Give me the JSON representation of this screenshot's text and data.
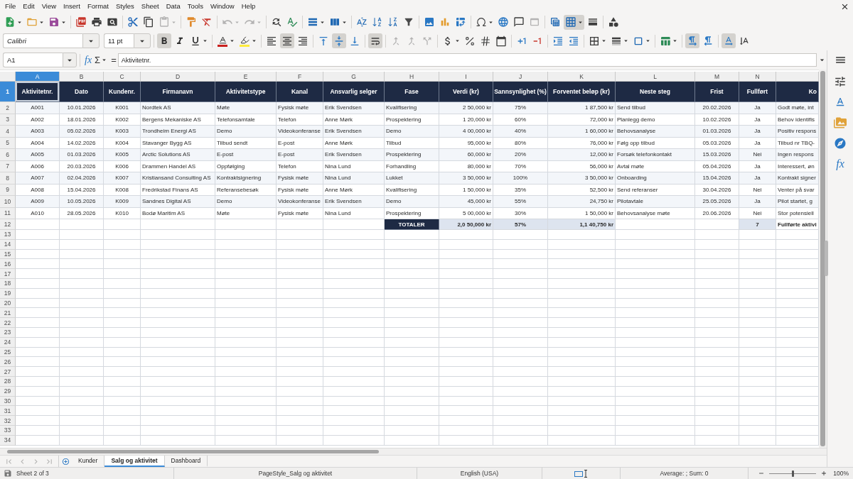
{
  "menu_bar": {
    "items": [
      "File",
      "Edit",
      "View",
      "Insert",
      "Format",
      "Styles",
      "Sheet",
      "Data",
      "Tools",
      "Window",
      "Help"
    ]
  },
  "standard_toolbar": {
    "groups": [
      {
        "buttons": [
          {
            "kind": "new",
            "pressed": false,
            "disabled": false,
            "dropdown": true
          },
          {
            "kind": "open",
            "pressed": false,
            "disabled": false,
            "dropdown": true
          },
          {
            "kind": "save",
            "pressed": false,
            "disabled": false,
            "dropdown": true
          }
        ]
      },
      {
        "buttons": [
          {
            "kind": "pdf",
            "pressed": false,
            "disabled": false,
            "dropdown": false
          },
          {
            "kind": "print",
            "pressed": false,
            "disabled": false,
            "dropdown": false
          },
          {
            "kind": "preview",
            "pressed": false,
            "disabled": false,
            "dropdown": false
          }
        ]
      },
      {
        "buttons": [
          {
            "kind": "cut",
            "pressed": false,
            "disabled": false,
            "dropdown": false
          },
          {
            "kind": "copy",
            "pressed": false,
            "disabled": false,
            "dropdown": false
          },
          {
            "kind": "paste",
            "pressed": false,
            "disabled": true,
            "dropdown": true
          }
        ]
      },
      {
        "buttons": [
          {
            "kind": "clone",
            "pressed": false,
            "disabled": false,
            "dropdown": false
          },
          {
            "kind": "clear",
            "pressed": false,
            "disabled": false,
            "dropdown": false
          }
        ]
      },
      {
        "buttons": [
          {
            "kind": "undo",
            "pressed": false,
            "disabled": true,
            "dropdown": true
          },
          {
            "kind": "redo",
            "pressed": false,
            "disabled": true,
            "dropdown": true
          }
        ]
      },
      {
        "buttons": [
          {
            "kind": "find",
            "pressed": false,
            "disabled": false,
            "dropdown": false
          },
          {
            "kind": "spelling",
            "pressed": false,
            "disabled": false,
            "dropdown": false
          }
        ]
      },
      {
        "buttons": [
          {
            "kind": "rows",
            "pressed": false,
            "disabled": false,
            "dropdown": true
          },
          {
            "kind": "columns",
            "pressed": false,
            "disabled": false,
            "dropdown": true
          }
        ]
      },
      {
        "buttons": [
          {
            "kind": "sort",
            "pressed": false,
            "disabled": false,
            "dropdown": false
          },
          {
            "kind": "ascending",
            "pressed": false,
            "disabled": false,
            "dropdown": false
          },
          {
            "kind": "descending",
            "pressed": false,
            "disabled": false,
            "dropdown": false
          },
          {
            "kind": "autofilter",
            "pressed": false,
            "disabled": false,
            "dropdown": false
          }
        ]
      },
      {
        "buttons": [
          {
            "kind": "image",
            "pressed": false,
            "disabled": false,
            "dropdown": false
          },
          {
            "kind": "chart",
            "pressed": false,
            "disabled": false,
            "dropdown": false
          },
          {
            "kind": "pivot",
            "pressed": false,
            "disabled": false,
            "dropdown": false
          }
        ]
      },
      {
        "buttons": [
          {
            "kind": "symbol",
            "pressed": false,
            "disabled": false,
            "dropdown": true
          },
          {
            "kind": "hyperlink",
            "pressed": false,
            "disabled": false,
            "dropdown": false
          },
          {
            "kind": "comment",
            "pressed": false,
            "disabled": false,
            "dropdown": false
          },
          {
            "kind": "headerfooter",
            "pressed": false,
            "disabled": true,
            "dropdown": false
          }
        ]
      },
      {
        "buttons": [
          {
            "kind": "printarea",
            "pressed": false,
            "disabled": false,
            "dropdown": false
          },
          {
            "kind": "freeze",
            "pressed": true,
            "disabled": false,
            "dropdown": true
          },
          {
            "kind": "split",
            "pressed": false,
            "disabled": false,
            "dropdown": false
          }
        ]
      },
      {
        "buttons": [
          {
            "kind": "draw",
            "pressed": false,
            "disabled": false,
            "dropdown": false
          }
        ]
      }
    ]
  },
  "formatting_toolbar": {
    "font_name": "Calibri",
    "font_size": "11 pt",
    "groups": [
      {
        "buttons": [
          {
            "kind": "bold",
            "pressed": true,
            "disabled": false,
            "dropdown": false
          },
          {
            "kind": "italic",
            "pressed": false,
            "disabled": false,
            "dropdown": false
          },
          {
            "kind": "underline",
            "pressed": false,
            "disabled": false,
            "dropdown": true
          }
        ]
      },
      {
        "buttons": [
          {
            "kind": "fontcolor",
            "pressed": false,
            "disabled": false,
            "dropdown": true
          },
          {
            "kind": "highlight",
            "pressed": false,
            "disabled": false,
            "dropdown": true
          }
        ]
      },
      {
        "buttons": [
          {
            "kind": "alignleft",
            "pressed": false,
            "disabled": false,
            "dropdown": false
          },
          {
            "kind": "aligncenter",
            "pressed": true,
            "disabled": false,
            "dropdown": false
          },
          {
            "kind": "alignright",
            "pressed": false,
            "disabled": false,
            "dropdown": false
          }
        ]
      },
      {
        "buttons": [
          {
            "kind": "aligntop",
            "pressed": false,
            "disabled": false,
            "dropdown": false
          },
          {
            "kind": "middle",
            "pressed": true,
            "disabled": false,
            "dropdown": false
          },
          {
            "kind": "alignbottom",
            "pressed": false,
            "disabled": false,
            "dropdown": false
          }
        ]
      },
      {
        "buttons": [
          {
            "kind": "wrap",
            "pressed": true,
            "disabled": false,
            "dropdown": false
          }
        ]
      },
      {
        "buttons": [
          {
            "kind": "mergecenter",
            "pressed": false,
            "disabled": true,
            "dropdown": false
          },
          {
            "kind": "merge",
            "pressed": false,
            "disabled": true,
            "dropdown": false
          },
          {
            "kind": "unmerge",
            "pressed": false,
            "disabled": true,
            "dropdown": false
          }
        ]
      },
      {
        "buttons": [
          {
            "kind": "currency",
            "pressed": false,
            "disabled": false,
            "dropdown": true
          },
          {
            "kind": "percent",
            "pressed": false,
            "disabled": false,
            "dropdown": false
          },
          {
            "kind": "number",
            "pressed": false,
            "disabled": false,
            "dropdown": false
          },
          {
            "kind": "date",
            "pressed": false,
            "disabled": false,
            "dropdown": false
          }
        ]
      },
      {
        "buttons": [
          {
            "kind": "adddecimal",
            "pressed": false,
            "disabled": false,
            "dropdown": false
          },
          {
            "kind": "deletedecimal",
            "pressed": false,
            "disabled": false,
            "dropdown": false
          }
        ]
      },
      {
        "buttons": [
          {
            "kind": "indent",
            "pressed": false,
            "disabled": false,
            "dropdown": false
          },
          {
            "kind": "outdent",
            "pressed": false,
            "disabled": false,
            "dropdown": false
          }
        ]
      },
      {
        "buttons": [
          {
            "kind": "borders",
            "pressed": false,
            "disabled": false,
            "dropdown": true
          },
          {
            "kind": "borderstyle",
            "pressed": false,
            "disabled": false,
            "dropdown": true
          },
          {
            "kind": "bordercolor",
            "pressed": false,
            "disabled": false,
            "dropdown": true
          }
        ]
      },
      {
        "buttons": [
          {
            "kind": "conditional",
            "pressed": false,
            "disabled": false,
            "dropdown": true
          }
        ]
      },
      {
        "buttons": [
          {
            "kind": "ltr",
            "pressed": true,
            "disabled": false,
            "dropdown": false
          },
          {
            "kind": "rtl",
            "pressed": false,
            "disabled": false,
            "dropdown": false
          }
        ]
      },
      {
        "buttons": [
          {
            "kind": "horizontal",
            "pressed": true,
            "disabled": false,
            "dropdown": false
          },
          {
            "kind": "vertical",
            "pressed": false,
            "disabled": false,
            "dropdown": false
          }
        ]
      }
    ]
  },
  "formula_bar": {
    "name_box": "A1",
    "function_glyph": "fx",
    "sum_glyph": "Σ",
    "equals_glyph": "=",
    "content": "Aktivitetnr."
  },
  "sheet": {
    "columns": [
      {
        "label": "A",
        "selected": true
      },
      {
        "label": "B",
        "selected": false
      },
      {
        "label": "C",
        "selected": false
      },
      {
        "label": "D",
        "selected": false
      },
      {
        "label": "E",
        "selected": false
      },
      {
        "label": "F",
        "selected": false
      },
      {
        "label": "G",
        "selected": false
      },
      {
        "label": "H",
        "selected": false
      },
      {
        "label": "I",
        "selected": false
      },
      {
        "label": "J",
        "selected": false
      },
      {
        "label": "K",
        "selected": false
      },
      {
        "label": "L",
        "selected": false
      },
      {
        "label": "M",
        "selected": false
      },
      {
        "label": "N",
        "selected": false
      },
      {
        "selected": false
      }
    ],
    "header_row": {
      "number": "1",
      "selected": true,
      "cells": [
        "Aktivitetnr.",
        "Dato",
        "Kundenr.",
        "Firmanavn",
        "Aktivitetstype",
        "Kanal",
        "Ansvarlig selger",
        "Fase",
        "Verdi (kr)",
        "Sannsynlighet (%)",
        "Forventet beløp (kr)",
        "Neste steg",
        "Frist",
        "Fullført",
        "Ko"
      ]
    },
    "rows": [
      {
        "number": "2",
        "selected": false,
        "cells": [
          "A001",
          "10.01.2026",
          "K001",
          "Nordtek AS",
          "Møte",
          "Fysisk møte",
          "Erik Svendsen",
          "Kvalifisering",
          "2 50,000 kr",
          "75%",
          "1 87,500 kr",
          "Send tilbud",
          "20.02.2026",
          "Ja",
          "Godt møte, int"
        ]
      },
      {
        "number": "3",
        "selected": false,
        "cells": [
          "A002",
          "18.01.2026",
          "K002",
          "Bergens Mekaniske AS",
          "Telefonsamtale",
          "Telefon",
          "Anne Mørk",
          "Prospektering",
          "1 20,000 kr",
          "60%",
          "72,000 kr",
          "Planlegg demo",
          "10.02.2026",
          "Ja",
          "Behov identifis"
        ]
      },
      {
        "number": "4",
        "selected": false,
        "cells": [
          "A003",
          "05.02.2026",
          "K003",
          "Trondheim Energi AS",
          "Demo",
          "Videokonferanse",
          "Erik Svendsen",
          "Demo",
          "4 00,000 kr",
          "40%",
          "1 60,000 kr",
          "Behovsanalyse",
          "01.03.2026",
          "Ja",
          "Positiv respons"
        ]
      },
      {
        "number": "5",
        "selected": false,
        "cells": [
          "A004",
          "14.02.2026",
          "K004",
          "Stavanger Bygg AS",
          "Tilbud sendt",
          "E-post",
          "Anne Mørk",
          "Tilbud",
          "95,000 kr",
          "80%",
          "76,000 kr",
          "Følg opp tilbud",
          "05.03.2026",
          "Ja",
          "Tilbud nr TBQ-"
        ]
      },
      {
        "number": "6",
        "selected": false,
        "cells": [
          "A005",
          "01.03.2026",
          "K005",
          "Arctic Solutions AS",
          "E-post",
          "E-post",
          "Erik Svendsen",
          "Prospektering",
          "60,000 kr",
          "20%",
          "12,000 kr",
          "Forsøk telefonkontakt",
          "15.03.2026",
          "Nei",
          "Ingen respons"
        ]
      },
      {
        "number": "7",
        "selected": false,
        "cells": [
          "A006",
          "20.03.2026",
          "K006",
          "Drammen Handel AS",
          "Oppfølging",
          "Telefon",
          "Nina Lund",
          "Forhandling",
          "80,000 kr",
          "70%",
          "56,000 kr",
          "Avtal møte",
          "05.04.2026",
          "Ja",
          "Interessert, øn"
        ]
      },
      {
        "number": "8",
        "selected": false,
        "cells": [
          "A007",
          "02.04.2026",
          "K007",
          "Kristiansand Consulting AS",
          "Kontraktsignering",
          "Fysisk møte",
          "Nina Lund",
          "Lukket",
          "3 50,000 kr",
          "100%",
          "3 50,000 kr",
          "Onboarding",
          "15.04.2026",
          "Ja",
          "Kontrakt signer"
        ]
      },
      {
        "number": "9",
        "selected": false,
        "cells": [
          "A008",
          "15.04.2026",
          "K008",
          "Fredrikstad Finans AS",
          "Referansebesøk",
          "Fysisk møte",
          "Anne Mørk",
          "Kvalifisering",
          "1 50,000 kr",
          "35%",
          "52,500 kr",
          "Send referanser",
          "30.04.2026",
          "Nei",
          "Venter på svar"
        ]
      },
      {
        "number": "10",
        "selected": false,
        "cells": [
          "A009",
          "10.05.2026",
          "K009",
          "Sandnes Digital AS",
          "Demo",
          "Videokonferanse",
          "Erik Svendsen",
          "Demo",
          "45,000 kr",
          "55%",
          "24,750 kr",
          "Pilotavtale",
          "25.05.2026",
          "Ja",
          "Pilot startet, g"
        ]
      },
      {
        "number": "11",
        "selected": false,
        "cells": [
          "A010",
          "28.05.2026",
          "K010",
          "Bodø Maritim AS",
          "Møte",
          "Fysisk møte",
          "Nina Lund",
          "Prospektering",
          "5 00,000 kr",
          "30%",
          "1 50,000 kr",
          "Behovsanalyse møte",
          "20.06.2026",
          "Nei",
          "Stor potensiell"
        ]
      }
    ],
    "totals_row": {
      "number": "12",
      "selected": false,
      "label": "TOTALER",
      "value_total": "2,0 50,000 kr",
      "probability_average": "57%",
      "expected_total": "1,1 40,750 kr",
      "completed_count": "7",
      "note": "Fullførte aktivi"
    },
    "empty_rows": [
      {
        "number": "13",
        "selected": false
      },
      {
        "number": "14",
        "selected": false
      },
      {
        "number": "15",
        "selected": false
      },
      {
        "number": "16",
        "selected": false
      },
      {
        "number": "17",
        "selected": false
      },
      {
        "number": "18",
        "selected": false
      },
      {
        "number": "19",
        "selected": false
      },
      {
        "number": "20",
        "selected": false
      },
      {
        "number": "21",
        "selected": false
      },
      {
        "number": "22",
        "selected": false
      },
      {
        "number": "23",
        "selected": false
      },
      {
        "number": "24",
        "selected": false
      },
      {
        "number": "25",
        "selected": false
      },
      {
        "number": "26",
        "selected": false
      },
      {
        "number": "27",
        "selected": false
      },
      {
        "number": "28",
        "selected": false
      },
      {
        "number": "29",
        "selected": false
      },
      {
        "number": "30",
        "selected": false
      },
      {
        "number": "31",
        "selected": false
      },
      {
        "number": "32",
        "selected": false
      },
      {
        "number": "33",
        "selected": false
      },
      {
        "number": "34",
        "selected": false
      }
    ]
  },
  "sheet_tabs": [
    {
      "label": "Kunder",
      "selected": false
    },
    {
      "label": "Salg og aktivitet",
      "selected": true
    },
    {
      "label": "Dashboard",
      "selected": false
    }
  ],
  "sidebar": {
    "buttons": [
      {
        "kind": "properties",
        "selected": false
      },
      {
        "kind": "styles",
        "selected": false
      },
      {
        "kind": "gallery",
        "selected": false
      },
      {
        "kind": "navigator",
        "selected": false
      },
      {
        "kind": "functions",
        "selected": false,
        "glyph": "fx"
      }
    ]
  },
  "status_bar": {
    "sheet": "Sheet 2 of 3",
    "page_style": "PageStyle_Salg og aktivitet",
    "language": "English (USA)",
    "selection_summary": "Average: ; Sum: 0",
    "zoom": {
      "level": 0.5,
      "reading": "100%"
    }
  }
}
